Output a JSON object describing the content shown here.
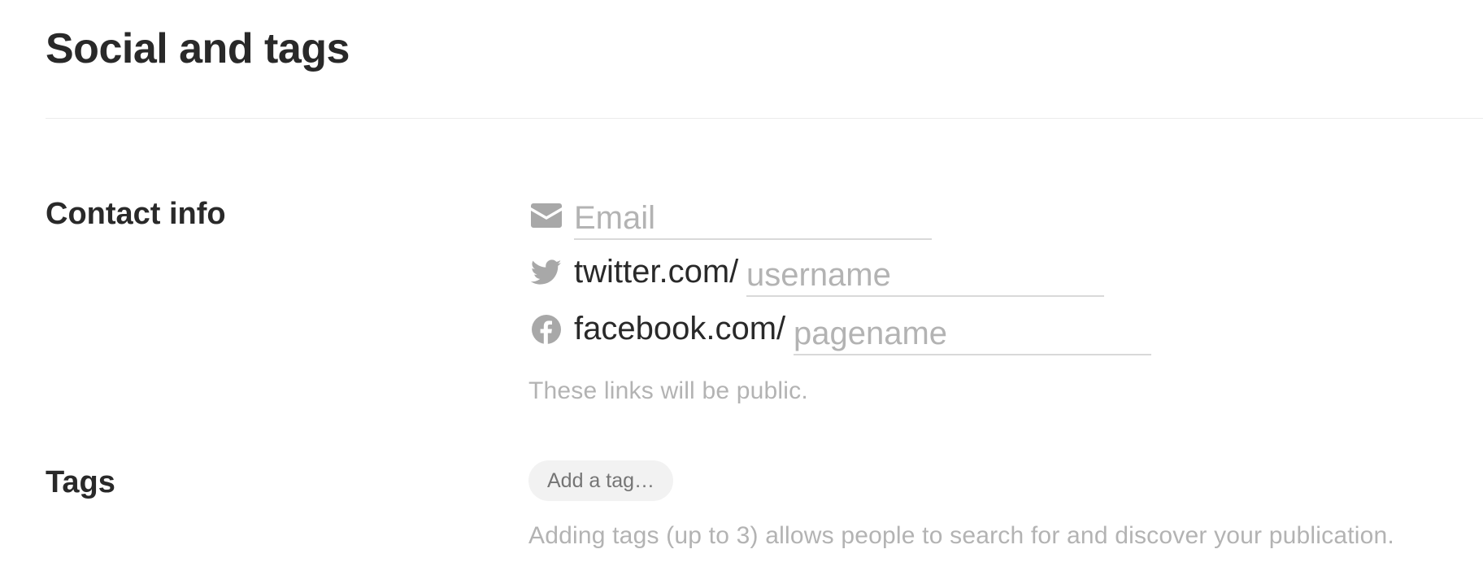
{
  "page": {
    "title": "Social and tags"
  },
  "contact": {
    "label": "Contact info",
    "email": {
      "icon": "envelope-icon",
      "placeholder": "Email",
      "value": ""
    },
    "twitter": {
      "icon": "twitter-icon",
      "prefix": "twitter.com/",
      "placeholder": "username",
      "value": ""
    },
    "facebook": {
      "icon": "facebook-icon",
      "prefix": "facebook.com/",
      "placeholder": "pagename",
      "value": ""
    },
    "note": "These links will be public."
  },
  "tags": {
    "label": "Tags",
    "add_label": "Add a tag…",
    "note": "Adding tags (up to 3) allows people to search for and discover your publication."
  },
  "colors": {
    "text": "#292929",
    "muted": "#b3b3b3",
    "icon": "#a8a8a8",
    "underline": "#d9d9d9",
    "pill": "#f2f2f2"
  }
}
